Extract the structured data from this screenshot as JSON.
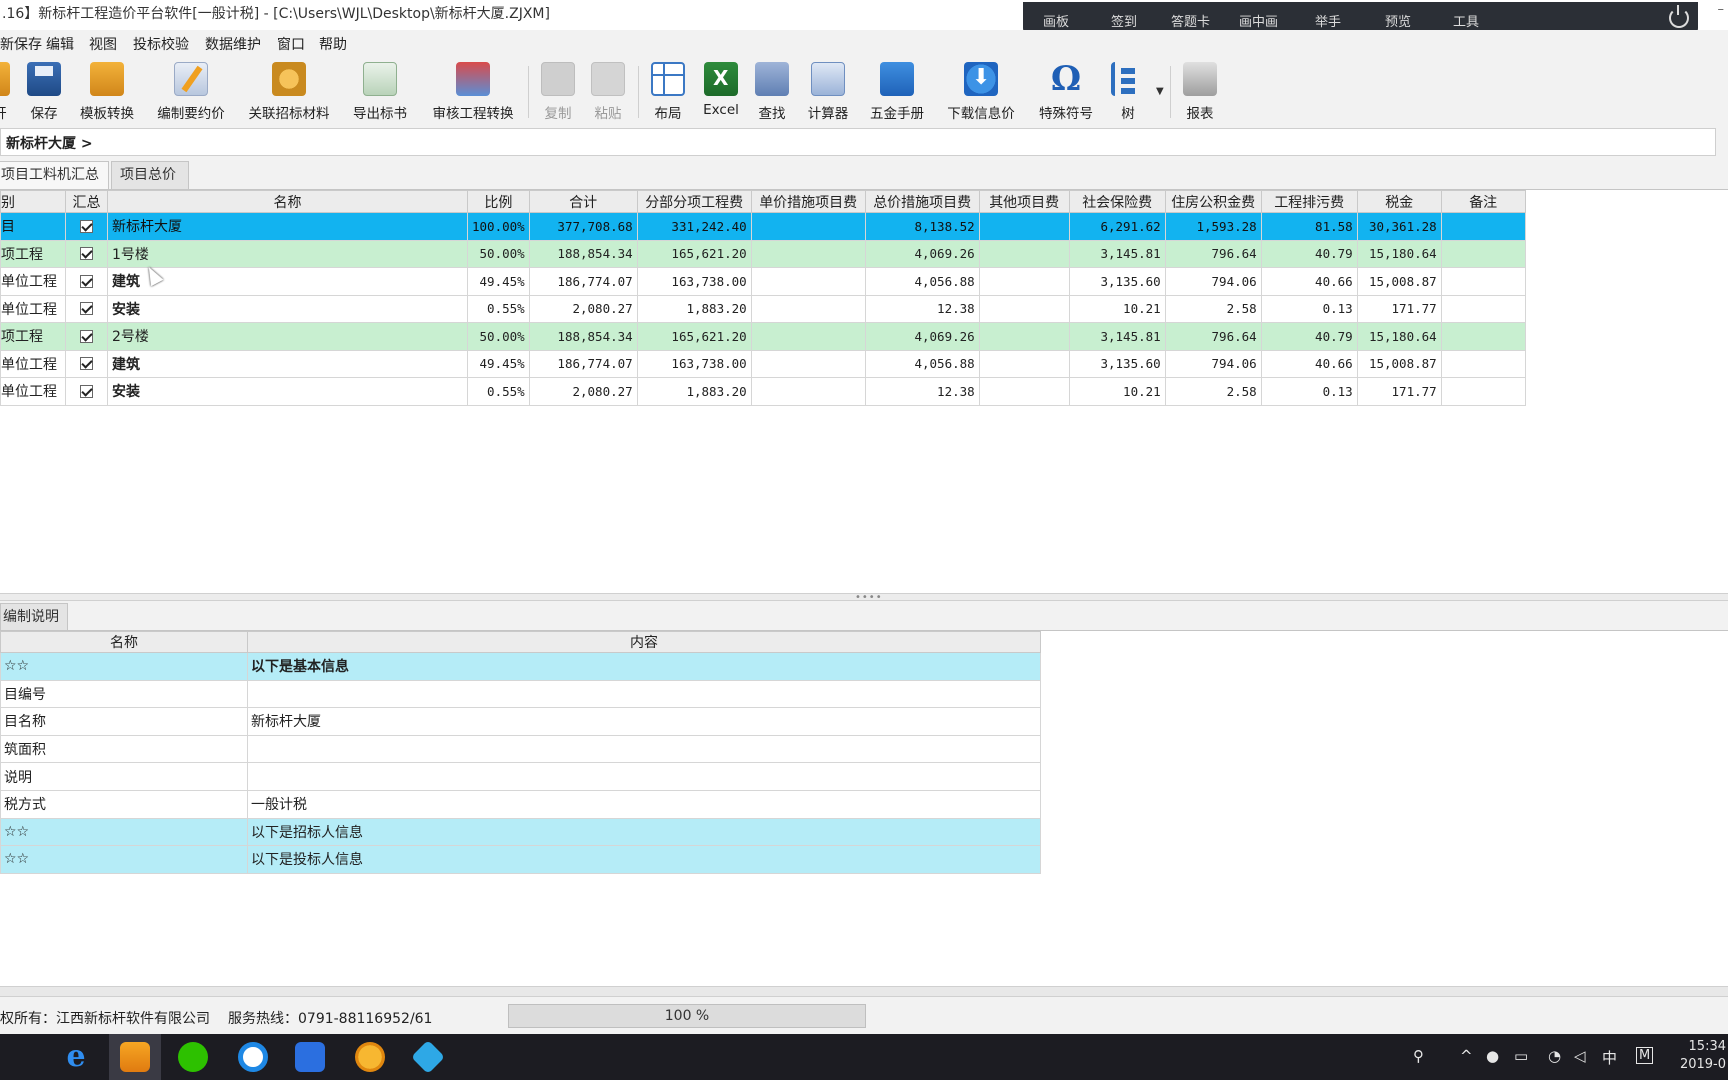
{
  "window": {
    "title": ".16】新标杆工程造价平台软件[一般计税] - [C:\\Users\\WJL\\Desktop\\新标杆大厦.ZJXM]",
    "minimize": "–"
  },
  "meeting_bar": {
    "items": [
      "画板",
      "签到",
      "答题卡",
      "画中画",
      "举手",
      "预览",
      "工具"
    ]
  },
  "menu": [
    "新保存",
    "编辑",
    "视图",
    "投标校验",
    "数据维护",
    "窗口",
    "帮助"
  ],
  "toolbar": {
    "open": "开",
    "save": "保存",
    "template_convert": "模板转换",
    "edit_notes": "编制要约价",
    "link_materials": "关联招标材料",
    "export_bid": "导出标书",
    "audit_convert": "审核工程转换",
    "copy": "复制",
    "paste": "粘贴",
    "layout": "布局",
    "excel": "Excel",
    "find": "查找",
    "calculator": "计算器",
    "hardware_manual": "五金手册",
    "download_price": "下载信息价",
    "special_symbols": "特殊符号",
    "tree": "树",
    "reports": "报表"
  },
  "breadcrumb": "新标杆大厦 >",
  "tabs": [
    "项目工料机汇总",
    "项目总价"
  ],
  "grid": {
    "headers": [
      "别",
      "汇总",
      "名称",
      "比例",
      "合计",
      "分部分项工程费",
      "单价措施项目费",
      "总价措施项目费",
      "其他项目费",
      "社会保险费",
      "住房公积金费",
      "工程排污费",
      "税金",
      "备注"
    ],
    "rows": [
      {
        "type": "目",
        "name": "新标杆大厦",
        "ratio": "100.00%",
        "total": "377,708.68",
        "fbfx": "331,242.40",
        "djcs": "",
        "zjcs": "8,138.52",
        "other": "",
        "social": "6,291.62",
        "housing": "1,593.28",
        "sewage": "81.58",
        "tax": "30,361.28",
        "note": ""
      },
      {
        "type": "项工程",
        "name": "1号楼",
        "ratio": "50.00%",
        "total": "188,854.34",
        "fbfx": "165,621.20",
        "djcs": "",
        "zjcs": "4,069.26",
        "other": "",
        "social": "3,145.81",
        "housing": "796.64",
        "sewage": "40.79",
        "tax": "15,180.64",
        "note": ""
      },
      {
        "type": "单位工程",
        "name": "建筑",
        "ratio": "49.45%",
        "total": "186,774.07",
        "fbfx": "163,738.00",
        "djcs": "",
        "zjcs": "4,056.88",
        "other": "",
        "social": "3,135.60",
        "housing": "794.06",
        "sewage": "40.66",
        "tax": "15,008.87",
        "note": ""
      },
      {
        "type": "单位工程",
        "name": "安装",
        "ratio": "0.55%",
        "total": "2,080.27",
        "fbfx": "1,883.20",
        "djcs": "",
        "zjcs": "12.38",
        "other": "",
        "social": "10.21",
        "housing": "2.58",
        "sewage": "0.13",
        "tax": "171.77",
        "note": ""
      },
      {
        "type": "项工程",
        "name": "2号楼",
        "ratio": "50.00%",
        "total": "188,854.34",
        "fbfx": "165,621.20",
        "djcs": "",
        "zjcs": "4,069.26",
        "other": "",
        "social": "3,145.81",
        "housing": "796.64",
        "sewage": "40.79",
        "tax": "15,180.64",
        "note": ""
      },
      {
        "type": "单位工程",
        "name": "建筑",
        "ratio": "49.45%",
        "total": "186,774.07",
        "fbfx": "163,738.00",
        "djcs": "",
        "zjcs": "4,056.88",
        "other": "",
        "social": "3,135.60",
        "housing": "794.06",
        "sewage": "40.66",
        "tax": "15,008.87",
        "note": ""
      },
      {
        "type": "单位工程",
        "name": "安装",
        "ratio": "0.55%",
        "total": "2,080.27",
        "fbfx": "1,883.20",
        "djcs": "",
        "zjcs": "12.38",
        "other": "",
        "social": "10.21",
        "housing": "2.58",
        "sewage": "0.13",
        "tax": "171.77",
        "note": ""
      }
    ]
  },
  "bottom": {
    "tab": "编制说明",
    "headers": [
      "名称",
      "内容"
    ],
    "rows": [
      {
        "name": "☆☆",
        "content": "以下是基本信息"
      },
      {
        "name": "目编号",
        "content": ""
      },
      {
        "name": "目名称",
        "content": "新标杆大厦"
      },
      {
        "name": "筑面积",
        "content": ""
      },
      {
        "name": "说明",
        "content": ""
      },
      {
        "name": "税方式",
        "content": "一般计税"
      },
      {
        "name": "☆☆",
        "content": "以下是招标人信息"
      },
      {
        "name": "☆☆",
        "content": "以下是投标人信息"
      }
    ]
  },
  "status": {
    "copyright": "权所有：江西新标杆软件有限公司",
    "hotline": "服务热线：0791-88116952/61",
    "progress_text": "100 %",
    "progress_value": 100
  },
  "taskbar": {
    "tray_ime": "中",
    "tray_m": "M",
    "time": "15:34",
    "date": "2019-0"
  },
  "colors": {
    "selected_row": "#12b3f0",
    "group_row": "#c8efd0",
    "info_row": "#b5ecf7"
  }
}
